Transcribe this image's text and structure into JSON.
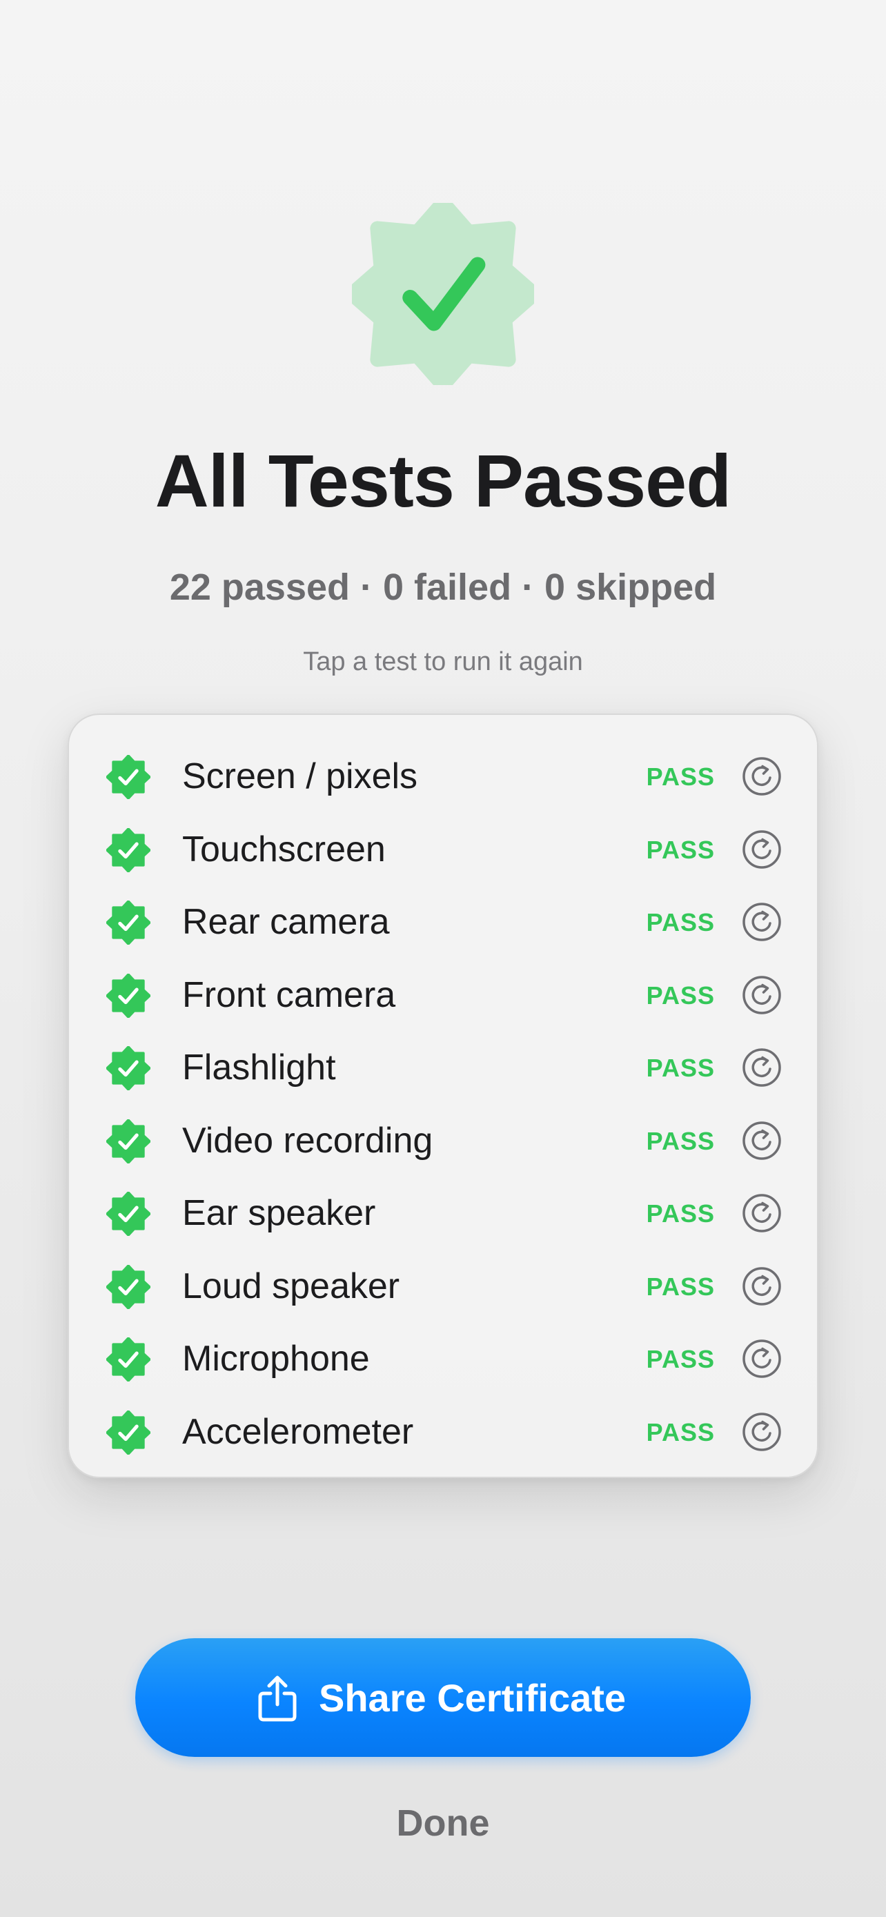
{
  "header": {
    "title": "All Tests Passed",
    "summary": "22 passed · 0 failed · 0 skipped",
    "hint": "Tap a test to run it again",
    "badge_icon": "checkmark-seal-icon"
  },
  "tests": [
    {
      "label": "Screen / pixels",
      "status": "PASS"
    },
    {
      "label": "Touchscreen",
      "status": "PASS"
    },
    {
      "label": "Rear camera",
      "status": "PASS"
    },
    {
      "label": "Front camera",
      "status": "PASS"
    },
    {
      "label": "Flashlight",
      "status": "PASS"
    },
    {
      "label": "Video recording",
      "status": "PASS"
    },
    {
      "label": "Ear speaker",
      "status": "PASS"
    },
    {
      "label": "Loud speaker",
      "status": "PASS"
    },
    {
      "label": "Microphone",
      "status": "PASS"
    },
    {
      "label": "Accelerometer",
      "status": "PASS"
    }
  ],
  "row_icons": {
    "status": "checkmark-seal-icon",
    "rerun": "rerun-arrow-icon"
  },
  "actions": {
    "share_label": "Share Certificate",
    "share_icon": "share-icon",
    "done_label": "Done"
  },
  "colors": {
    "pass_green": "#34c759",
    "badge_fill": "#c4e8cd",
    "accent_blue": "#0a84ff",
    "secondary_text": "#6b6b6e"
  }
}
